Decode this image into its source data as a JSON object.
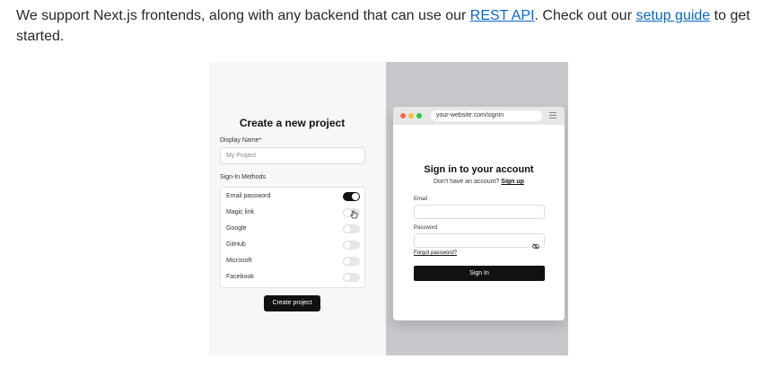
{
  "intro": {
    "text_before": "We support Next.js frontends, along with any backend that can use our ",
    "rest_api_link": "REST API",
    "text_middle": ". Check out our ",
    "setup_guide_link": "setup guide",
    "text_after": " to get started."
  },
  "create_project": {
    "title": "Create a new project",
    "display_name_label": "Display Name*",
    "display_name_placeholder": "My Project",
    "sign_in_methods_label": "Sign-In Methods",
    "methods": [
      {
        "label": "Email password",
        "enabled": true
      },
      {
        "label": "Magic link",
        "enabled": false
      },
      {
        "label": "Google",
        "enabled": false
      },
      {
        "label": "GitHub",
        "enabled": false
      },
      {
        "label": "Microsoft",
        "enabled": false
      },
      {
        "label": "Facebook",
        "enabled": false
      }
    ],
    "create_button": "Create project"
  },
  "browser": {
    "url": "your-website.com/signin",
    "dot_colors": [
      "#ff5f57",
      "#febc2e",
      "#28c840"
    ],
    "menu_icon": "hamburger-icon",
    "signin": {
      "title": "Sign in to your account",
      "no_account_text": "Don't have an account? ",
      "sign_up_link": "Sign up",
      "email_label": "Email",
      "password_label": "Password",
      "password_icon": "eye-off-icon",
      "forgot_link": "Forgot password?",
      "sign_in_button": "Sign In"
    }
  }
}
